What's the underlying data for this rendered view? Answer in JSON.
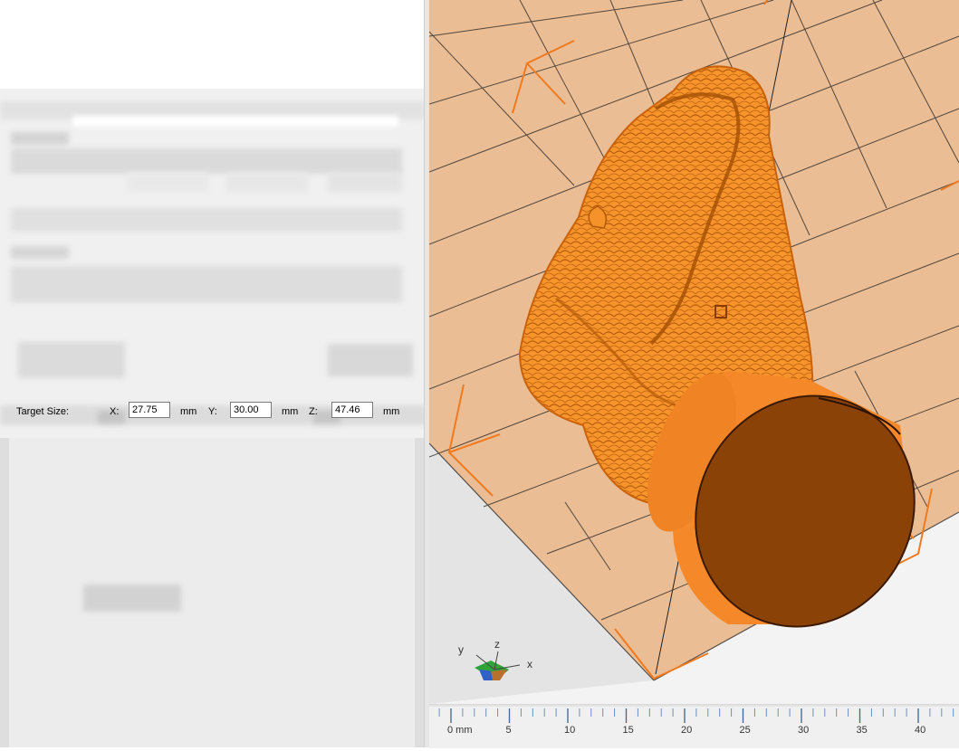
{
  "target_size": {
    "label": "Target Size:",
    "x_label": "X:",
    "x_value": "27.75",
    "y_label": "Y:",
    "y_value": "30.00",
    "z_label": "Z:",
    "z_value": "47.46",
    "unit": "mm"
  },
  "axis_gizmo": {
    "x_label": "x",
    "y_label": "y",
    "z_label": "z"
  },
  "ruler": {
    "ticks": [
      {
        "value": 0,
        "label": "0 mm"
      },
      {
        "value": 5,
        "label": "5"
      },
      {
        "value": 10,
        "label": "10"
      },
      {
        "value": 15,
        "label": "15"
      },
      {
        "value": 20,
        "label": "20"
      },
      {
        "value": 25,
        "label": "25"
      },
      {
        "value": 30,
        "label": "30"
      },
      {
        "value": 35,
        "label": "35"
      },
      {
        "value": 40,
        "label": "40"
      }
    ]
  },
  "colors": {
    "model": "#f58a1f",
    "build_plate": "#ebbd94",
    "selection_box": "#f07a20",
    "base_face": "#8a4206"
  },
  "icons": {
    "gizmo": "axis-orientation-icon"
  }
}
